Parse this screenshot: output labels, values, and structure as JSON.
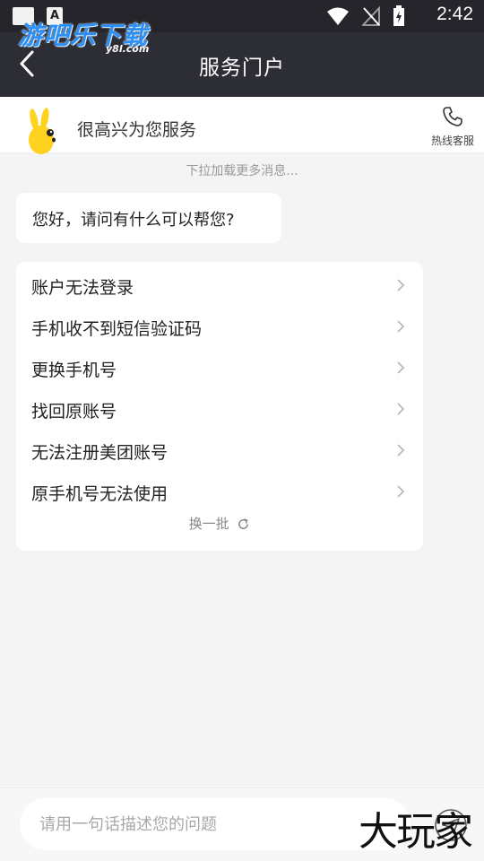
{
  "status_bar": {
    "time": "2:42",
    "app_letter": "A"
  },
  "header": {
    "title": "服务门户"
  },
  "logo": {
    "main": "游吧乐下载",
    "sub": "y8l.com"
  },
  "service": {
    "greeting": "很高兴为您服务",
    "hotline_label": "热线客服"
  },
  "chat": {
    "pull_hint": "下拉加载更多消息...",
    "bot_message": "您好，请问有什么可以帮您?"
  },
  "faq": {
    "items": [
      {
        "label": "账户无法登录"
      },
      {
        "label": "手机收不到短信验证码"
      },
      {
        "label": "更换手机号"
      },
      {
        "label": "找回原账号"
      },
      {
        "label": "无法注册美团账号"
      },
      {
        "label": "原手机号无法使用"
      }
    ],
    "refresh_label": "换一批"
  },
  "input": {
    "placeholder": "请用一句话描述您的问题",
    "value": ""
  },
  "watermark": {
    "brand": "大玩家"
  },
  "colors": {
    "header_bg": "#2d2e35",
    "status_bg": "#25252b",
    "page_bg": "#f4f4f4",
    "logo_blue": "#2a8ff7"
  }
}
